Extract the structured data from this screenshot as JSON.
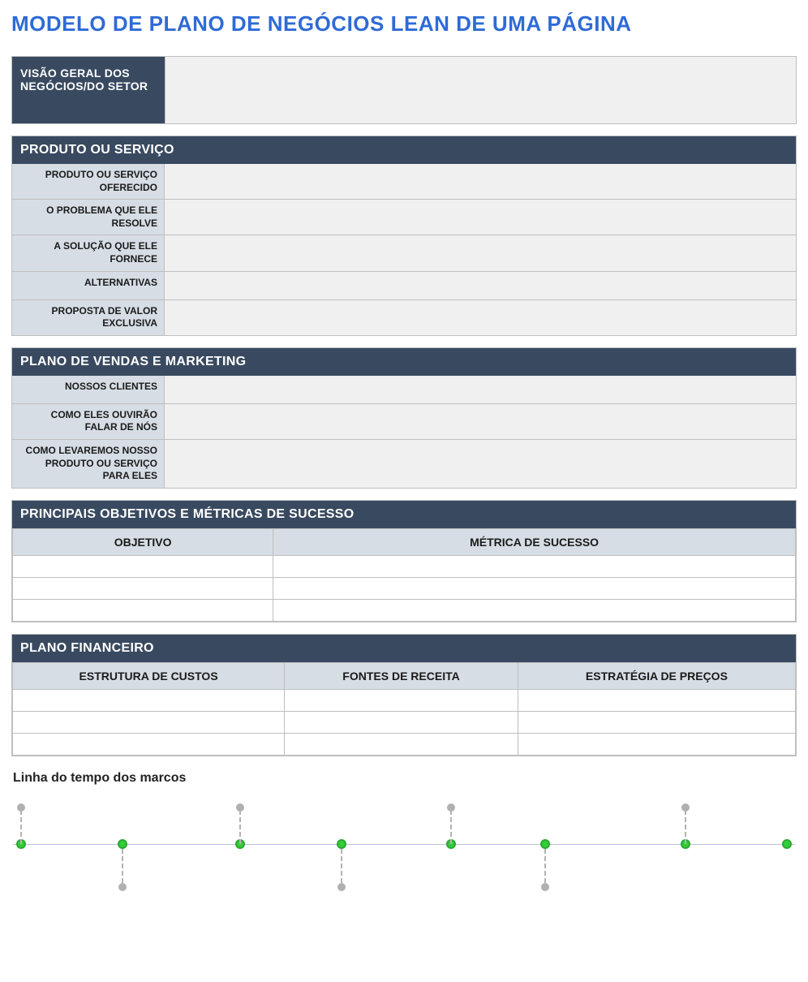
{
  "title": "MODELO DE PLANO DE NEGÓCIOS LEAN DE UMA PÁGINA",
  "overview": {
    "label": "VISÃO GERAL DOS NEGÓCIOS/DO SETOR",
    "value": ""
  },
  "product": {
    "header": "PRODUTO OU SERVIÇO",
    "rows": [
      {
        "label": "PRODUTO OU SERVIÇO OFERECIDO",
        "value": ""
      },
      {
        "label": "O PROBLEMA QUE ELE RESOLVE",
        "value": ""
      },
      {
        "label": "A SOLUÇÃO QUE ELE FORNECE",
        "value": ""
      },
      {
        "label": "ALTERNATIVAS",
        "value": ""
      },
      {
        "label": "PROPOSTA DE VALOR EXCLUSIVA",
        "value": ""
      }
    ]
  },
  "sales": {
    "header": "PLANO DE VENDAS E MARKETING",
    "rows": [
      {
        "label": "NOSSOS CLIENTES",
        "value": ""
      },
      {
        "label": "COMO ELES OUVIRÃO FALAR DE NÓS",
        "value": ""
      },
      {
        "label": "COMO LEVAREMOS NOSSO PRODUTO OU SERVIÇO PARA ELES",
        "value": ""
      }
    ]
  },
  "objectives": {
    "header": "PRINCIPAIS OBJETIVOS E MÉTRICAS DE SUCESSO",
    "columns": [
      "OBJETIVO",
      "MÉTRICA DE SUCESSO"
    ],
    "rows": [
      [
        "",
        ""
      ],
      [
        "",
        ""
      ],
      [
        "",
        ""
      ]
    ]
  },
  "finance": {
    "header": "PLANO FINANCEIRO",
    "columns": [
      "ESTRUTURA DE CUSTOS",
      "FONTES DE RECEITA",
      "ESTRATÉGIA DE PREÇOS"
    ],
    "rows": [
      [
        "",
        "",
        ""
      ],
      [
        "",
        "",
        ""
      ],
      [
        "",
        "",
        ""
      ]
    ]
  },
  "timeline": {
    "title": "Linha do tempo dos marcos",
    "nodes": [
      {
        "pos": 1,
        "stem": "up"
      },
      {
        "pos": 14,
        "stem": "down"
      },
      {
        "pos": 29,
        "stem": "up"
      },
      {
        "pos": 42,
        "stem": "down"
      },
      {
        "pos": 56,
        "stem": "up"
      },
      {
        "pos": 68,
        "stem": "down"
      },
      {
        "pos": 86,
        "stem": "up"
      },
      {
        "pos": 99,
        "stem": "none"
      }
    ]
  }
}
